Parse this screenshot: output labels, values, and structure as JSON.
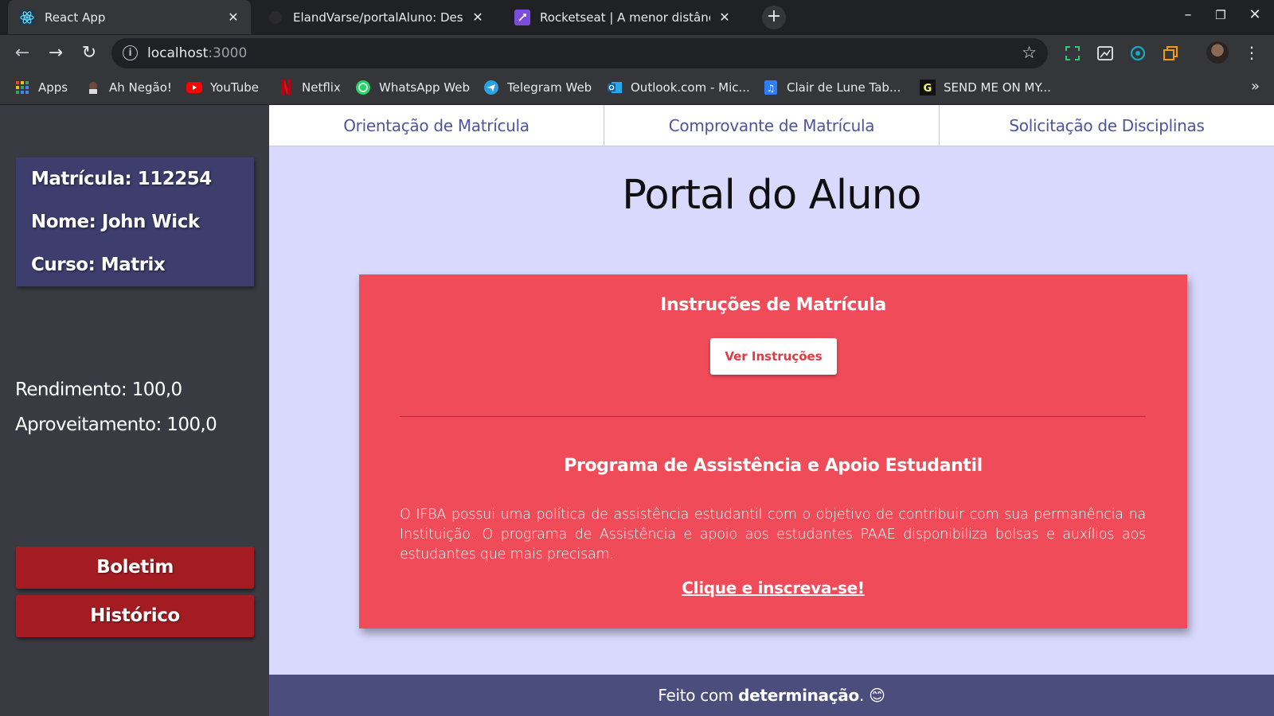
{
  "browser": {
    "tabs": [
      {
        "title": "React App",
        "icon": "react-icon",
        "active": true
      },
      {
        "title": "ElandVarse/portalAluno: Design",
        "icon": "github-icon",
        "active": false
      },
      {
        "title": "Rocketseat | A menor distância",
        "icon": "rocketseat-icon",
        "active": false
      }
    ],
    "new_tab_symbol": "+",
    "address": {
      "host": "localhost",
      "port": ":3000"
    },
    "bookmarks": [
      {
        "label": "Apps",
        "icon": "apps-grid-icon"
      },
      {
        "label": "Ah Negão!",
        "icon": "ah-negao-icon"
      },
      {
        "label": "YouTube",
        "icon": "youtube-icon"
      },
      {
        "label": "Netflix",
        "icon": "netflix-icon"
      },
      {
        "label": "WhatsApp Web",
        "icon": "whatsapp-icon"
      },
      {
        "label": "Telegram Web",
        "icon": "telegram-icon"
      },
      {
        "label": "Outlook.com - Mic...",
        "icon": "outlook-icon"
      },
      {
        "label": "Clair de Lune Tab...",
        "icon": "music-sheet-icon"
      },
      {
        "label": "SEND ME ON MY...",
        "icon": "genius-icon"
      }
    ],
    "more_bookmarks": "»"
  },
  "sidebar": {
    "matricula": "Matrícula: 112254",
    "nome": "Nome: John Wick",
    "curso": "Curso: Matrix",
    "rendimento": "Rendimento: 100,0",
    "aproveitamento": "Aproveitamento: 100,0",
    "boletim_label": "Boletim",
    "historico_label": "Histórico"
  },
  "nav": {
    "items": [
      "Orientação de Matrícula",
      "Comprovante de Matrícula",
      "Solicitação de Disciplinas"
    ]
  },
  "main": {
    "title": "Portal do Aluno",
    "instructions_heading": "Instruções de Matrícula",
    "ver_instrucoes_label": "Ver Instruções",
    "program_heading": "Programa de Assistência e Apoio Estudantil",
    "program_text": "O IFBA possui uma política de assistência estudantil com o objetivo de contribuir com sua permanência na Instituição. O programa de Assistência e apoio aos estudantes PAAE disponibiliza bolsas e auxílios aos estudantes que mais precisam.",
    "signup_link": "Clique e inscreva-se!"
  },
  "footer": {
    "prefix": "Feito com ",
    "emphasis": "determinação",
    "suffix": ". 😊"
  },
  "colors": {
    "sidebar_bg": "#3a3a42",
    "info_card_bg": "#3d3d6e",
    "button_red": "#a41c22",
    "main_bg": "#d9d9fd",
    "card_bg": "#f04b58",
    "nav_text": "#4e549c",
    "footer_bg": "#4b4e7c"
  }
}
